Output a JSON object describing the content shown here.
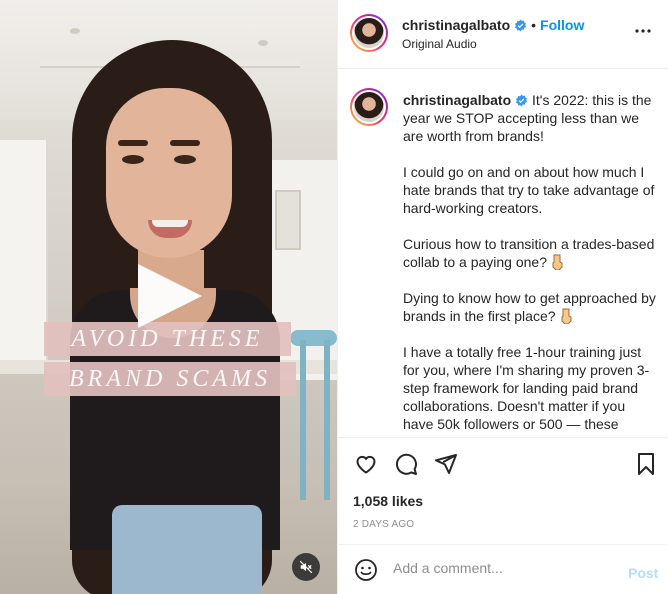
{
  "video": {
    "overlay_line_1": "AVOID THESE",
    "overlay_line_2": "BRAND SCAMS",
    "play_icon": "play-icon",
    "mute_icon": "speaker-muted-icon"
  },
  "header": {
    "username": "christinagalbato",
    "separator": "•",
    "follow_label": "Follow",
    "audio_label": "Original Audio",
    "more_icon": "more-horizontal-icon"
  },
  "caption": {
    "username": "christinagalbato",
    "paragraphs": [
      "It's 2022: this is the year we STOP accepting less than we are worth from brands!",
      "I could go on and on about how much I hate brands that try to take advantage of hard-working creators.",
      "Curious how to transition a trades-based collab to a paying one?",
      "Dying to know how to get approached by brands in the first place?",
      "I have a totally free 1-hour training just for you, where I'm sharing my proven 3-step framework for landing paid brand collaborations. Doesn't matter if you have 50k followers or 500 — these"
    ]
  },
  "actions": {
    "like_icon": "heart-icon",
    "comment_icon": "comment-icon",
    "share_icon": "share-icon",
    "save_icon": "bookmark-icon",
    "likes": "1,058 likes",
    "date": "2 DAYS AGO"
  },
  "comment": {
    "emoji_icon": "emoji-icon",
    "placeholder": "Add a comment...",
    "post_label": "Post"
  },
  "colors": {
    "accent": "#0095f6",
    "post_disabled": "#b2dffc",
    "banner": "#e2c0be"
  }
}
